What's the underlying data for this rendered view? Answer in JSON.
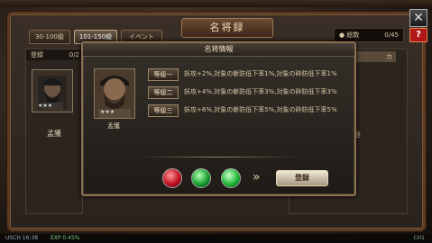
{
  "window": {
    "title": "名将録"
  },
  "tabs": [
    {
      "label": "30-100級",
      "active": false
    },
    {
      "label": "101-150級",
      "active": true
    },
    {
      "label": "イベント",
      "active": false
    }
  ],
  "total": {
    "label": "総数",
    "value": "0/45"
  },
  "left_panel": {
    "header_label": "登録",
    "header_count": "0/2",
    "general_name": "孟獲",
    "stars": "★★★"
  },
  "right_panel": {
    "tag": "カ",
    "text": "登"
  },
  "modal": {
    "title": "名将情報",
    "general_name": "孟獲",
    "stars": "★★★",
    "levels": [
      {
        "badge": "等級一",
        "desc": "妖攻+2%,対象の斬防低下率1%,対象の砕防低下率1%"
      },
      {
        "badge": "等級二",
        "desc": "妖攻+4%,対象の斬防低下率3%,対象の砕防低下率3%"
      },
      {
        "badge": "等級三",
        "desc": "妖攻+6%,対象の斬防低下率5%,対象の砕防低下率5%"
      }
    ],
    "register_label": "登録",
    "arrow": "»"
  },
  "statusbar": {
    "left": "USCH 16:38",
    "mid": "EXP 0.45%",
    "right": "CH1"
  },
  "colors": {
    "gem_red": "#c01020",
    "gem_green": "#18a030",
    "accent": "#8a7050"
  }
}
